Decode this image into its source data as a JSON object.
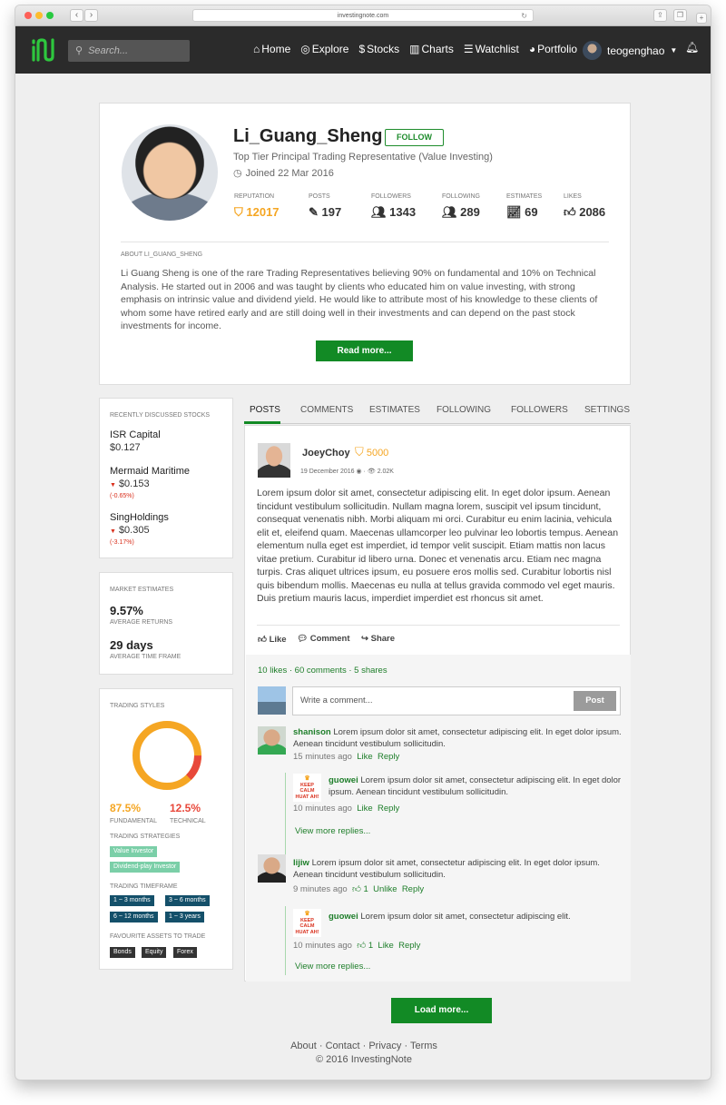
{
  "browser": {
    "url": "investingnote.com"
  },
  "nav": {
    "search_placeholder": "Search...",
    "links": [
      {
        "icon": "home-icon",
        "glyph": "⌂",
        "label": "Home"
      },
      {
        "icon": "compass-icon",
        "glyph": "◎",
        "label": "Explore"
      },
      {
        "icon": "dollar-icon",
        "glyph": "$",
        "label": "Stocks"
      },
      {
        "icon": "bar-chart-icon",
        "glyph": "▥",
        "label": "Charts"
      },
      {
        "icon": "list-icon",
        "glyph": "☰",
        "label": "Watchlist"
      },
      {
        "icon": "pie-chart-icon",
        "glyph": "◕",
        "label": "Portfolio"
      }
    ],
    "username": "teogenghao"
  },
  "profile": {
    "name": "Li_Guang_Sheng",
    "follow_label": "FOLLOW",
    "title": "Top Tier Principal Trading Representative (Value Investing)",
    "joined": "Joined 22 Mar 2016",
    "stats": [
      {
        "label": "REPUTATION",
        "value": "12017"
      },
      {
        "label": "POSTS",
        "value": "197"
      },
      {
        "label": "FOLLOWERS",
        "value": "1343"
      },
      {
        "label": "FOLLOWING",
        "value": "289"
      },
      {
        "label": "ESTIMATES",
        "value": "69"
      },
      {
        "label": "LIKES",
        "value": "2086"
      }
    ],
    "about_heading": "ABOUT LI_GUANG_SHENG",
    "about_text": "Li Guang Sheng is one of the rare Trading Representatives believing 90% on fundamental and 10% on Technical Analysis. He started out in 2006 and was taught by clients who educated him on value investing, with strong emphasis on intrinsic value and dividend yield. He would like to attribute most of his knowledge to these clients of whom some have retired early and are still doing well in their investments and can depend on the past stock investments for income.",
    "read_more": "Read more..."
  },
  "sidebar": {
    "recent_heading": "RECENTLY DISCUSSED STOCKS",
    "stocks": [
      {
        "name": "ISR Capital",
        "price": "$0.127",
        "change": ""
      },
      {
        "name": "Mermaid Maritime",
        "price": "$0.153",
        "change": "(-0.65%)"
      },
      {
        "name": "SingHoldings",
        "price": "$0.305",
        "change": "(-3.17%)"
      }
    ],
    "estimates_heading": "MARKET ESTIMATES",
    "avg_returns": "9.57%",
    "avg_returns_label": "AVERAGE RETURNS",
    "avg_time": "29 days",
    "avg_time_label": "AVERAGE TIME FRAME",
    "styles_heading": "TRADING STYLES",
    "fundamental_pct": "87.5%",
    "fundamental_label": "FUNDAMENTAL",
    "technical_pct": "12.5%",
    "technical_label": "TECHNICAL",
    "fundamental_fraction": 0.875,
    "strategies_heading": "TRADING STRATEGIES",
    "strategies": [
      "Value Investor",
      "Dividend-play Investor"
    ],
    "timeframe_heading": "TRADING TIMEFRAME",
    "timeframes": [
      "1 ~ 3 months",
      "3 ~ 6 months",
      "6 ~ 12 months",
      "1 ~ 3 years"
    ],
    "assets_heading": "FAVOURITE ASSETS TO TRADE",
    "assets": [
      "Bonds",
      "Equity",
      "Forex"
    ]
  },
  "tabs": [
    "POSTS",
    "COMMENTS",
    "ESTIMATES",
    "FOLLOWING",
    "FOLLOWERS",
    "SETTINGS"
  ],
  "post": {
    "author": "JoeyChoy",
    "reputation": "5000",
    "date": "19 December 2016",
    "views": "2.02K",
    "body": "Lorem ipsum dolor sit amet, consectetur adipiscing elit. In eget dolor ipsum. Aenean tincidunt vestibulum sollicitudin. Nullam magna lorem, suscipit vel ipsum tincidunt, consequat venenatis nibh. Morbi aliquam mi orci. Curabitur eu enim lacinia, vehicula elit et, eleifend quam. Maecenas ullamcorper leo pulvinar leo lobortis tempus. Aenean elementum nulla eget est imperdiet, id tempor velit suscipit. Etiam mattis non lacus vitae pretium. Curabitur id libero urna. Donec et venenatis arcu. Etiam nec magna turpis. Cras aliquet ultrices ipsum, eu posuere eros mollis sed. Curabitur lobortis nisl quis bibendum mollis. Maecenas eu nulla at tellus gravida commodo vel eget mauris. Duis pretium mauris lacus, imperdiet imperdiet est rhoncus sit amet.",
    "like_label": "Like",
    "comment_label": "Comment",
    "share_label": "Share",
    "likes": "10 likes",
    "comments": "60 comments",
    "shares": "5 shares",
    "comment_placeholder": "Write a comment...",
    "post_button": "Post"
  },
  "comments": [
    {
      "user": "shanison",
      "text": "Lorem ipsum dolor sit amet, consectetur adipiscing elit. In eget dolor ipsum. Aenean tincidunt vestibulum sollicitudin.",
      "time": "15 minutes ago",
      "likes": "",
      "like": "Like",
      "reply": "Reply"
    },
    {
      "user": "guowei",
      "text": "Lorem ipsum dolor sit amet, consectetur adipiscing elit. In eget dolor ipsum. Aenean tincidunt vestibulum sollicitudin.",
      "time": "10 minutes ago",
      "likes": "",
      "like": "Like",
      "reply": "Reply"
    },
    {
      "user": "lijiw",
      "text": "Lorem ipsum dolor sit amet, consectetur adipiscing elit. In eget dolor ipsum. Aenean tincidunt vestibulum sollicitudin.",
      "time": "9 minutes ago",
      "likes": "1",
      "like": "Unlike",
      "reply": "Reply"
    },
    {
      "user": "guowei",
      "text": "Lorem ipsum dolor sit amet, consectetur adipiscing elit.",
      "time": "10 minutes ago",
      "likes": "1",
      "like": "Like",
      "reply": "Reply"
    }
  ],
  "keep_calm": "KEEP CALM HUAT AH!",
  "view_more_replies": "View more replies...",
  "load_more": "Load more...",
  "footer": {
    "links": [
      "About",
      "Contact",
      "Privacy",
      "Terms"
    ],
    "separator": "·",
    "copyright": "© 2016 InvestingNote"
  },
  "colors": {
    "brand_green": "#128a25",
    "reputation_gold": "#f5a623",
    "technical_red": "#e8483a",
    "tag_teal": "#7bcfa8",
    "tag_navy": "#14506a"
  }
}
